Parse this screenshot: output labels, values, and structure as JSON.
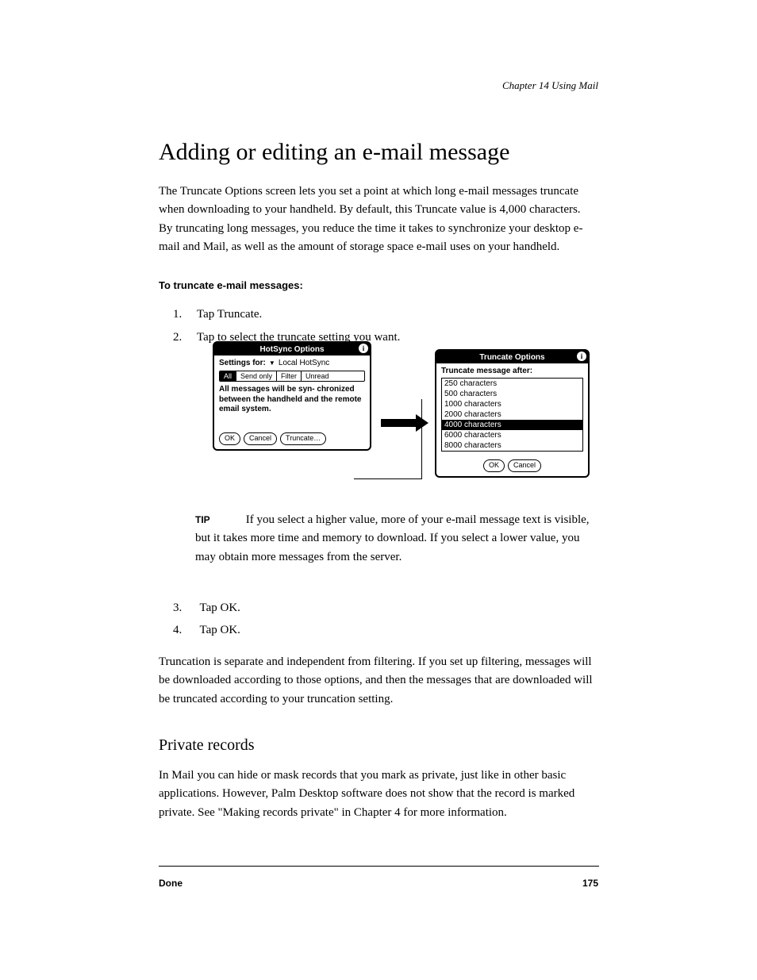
{
  "chapter_header": "Chapter 14    Using Mail",
  "section_title": "Adding or editing an e-mail message",
  "intro": "The Truncate Options screen lets you set a point at which long e-mail messages truncate when downloading to your handheld. By default, this Truncate value is 4,000 characters. By truncating long messages, you reduce the time it takes to synchronize your desktop e-mail and Mail, as well as the amount of storage space e-mail uses on your handheld.",
  "steps_heading": "To truncate e-mail messages:",
  "steps": [
    {
      "num": "1.",
      "text": "Tap Truncate."
    },
    {
      "num": "2.",
      "text": "Tap to select the truncate setting you want."
    }
  ],
  "dialog1": {
    "title": "HotSync Options",
    "settings_label": "Settings for:",
    "dropdown_value": "Local HotSync",
    "tabs": [
      "All",
      "Send only",
      "Filter",
      "Unread"
    ],
    "selected_tab": 0,
    "description": "All messages will be syn-\nchronized between the handheld and the remote email system.",
    "buttons": [
      "OK",
      "Cancel",
      "Truncate…"
    ]
  },
  "dialog2": {
    "title": "Truncate Options",
    "label": "Truncate message after:",
    "options": [
      "250 characters",
      "500 characters",
      "1000 characters",
      "2000 characters",
      "4000 characters",
      "6000 characters",
      "8000 characters"
    ],
    "selected_index": 4,
    "buttons": [
      "OK",
      "Cancel"
    ]
  },
  "note_label": "TIP",
  "note_text": "If you select a higher value, more of your e-mail message text is visible, but it takes more time and memory to download. If you select a lower value, you may obtain more messages from the server.",
  "step3": {
    "num": "3.",
    "text": "Tap OK."
  },
  "step4": {
    "num": "4.",
    "text": "Tap OK."
  },
  "outro": "Truncation is separate and independent from filtering. If you set up filtering, messages will be downloaded according to those options, and then the messages that are downloaded will be truncated according to your truncation setting.",
  "subheading": "Private records",
  "subtext": "In Mail you can hide or mask records that you mark as private, just like in other basic applications. However, Palm Desktop software does not show that the record is marked private. See \"Making records private\" in Chapter 4 for more information.",
  "footer_left": "Done",
  "footer_right": "175"
}
